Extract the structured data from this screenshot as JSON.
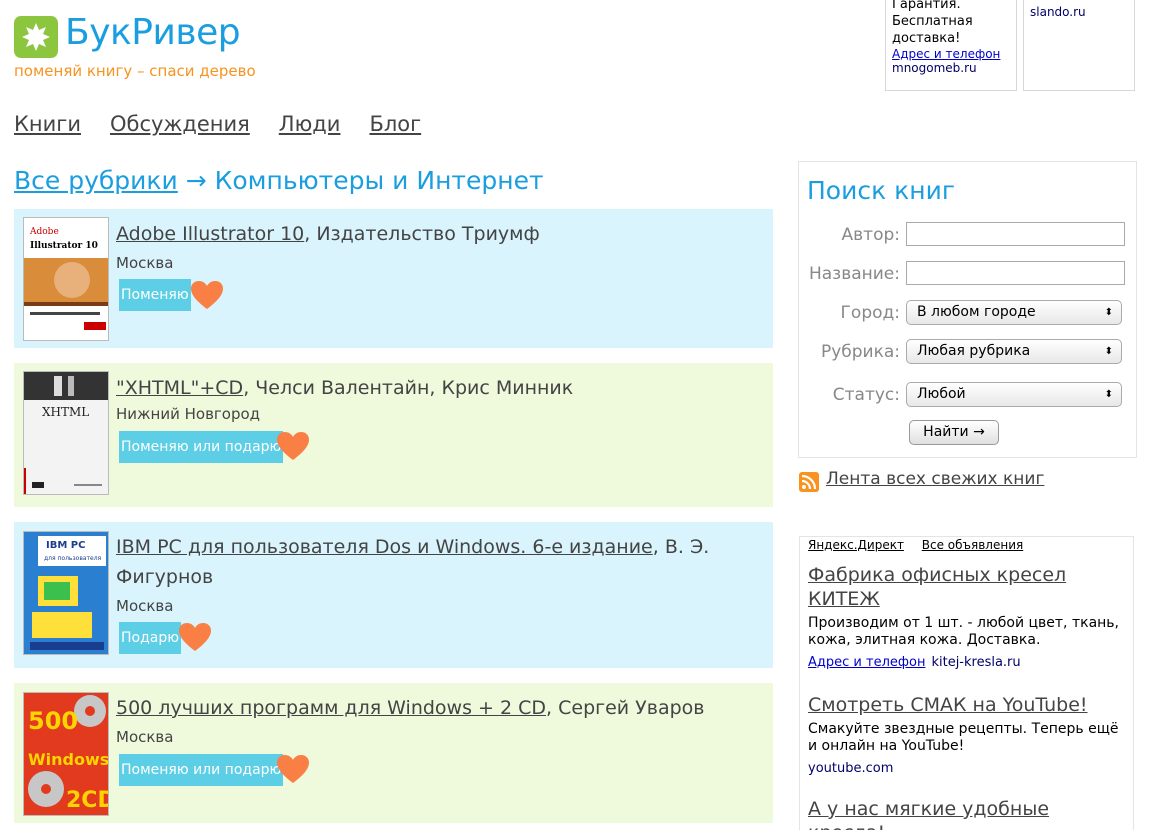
{
  "logo": {
    "name": "БукРивер",
    "slogan": "поменяй книгу – спаси дерево"
  },
  "top_ads": [
    {
      "text": "Гарантия. Бесплатная доставка!",
      "link": "Адрес и телефон",
      "domain": "mnogomeb.ru"
    },
    {
      "text": "",
      "link": "",
      "domain": "slando.ru"
    }
  ],
  "nav": [
    "Книги",
    "Обсуждения",
    "Люди",
    "Блог"
  ],
  "breadcrumb": {
    "root": "Все рубрики",
    "arrow": "→",
    "current": "Компьютеры и Интернет"
  },
  "books": [
    {
      "title": "Adobe Illustrator 10",
      "author": ", Издательство Триумф",
      "city": "Москва",
      "status": "Поменяю",
      "cover": "adobe-illustrator-cover"
    },
    {
      "title": "\"XHTML\"+CD",
      "author": ", Челси Валентайн, Крис Минник",
      "city": "Нижний Новгород",
      "status": "Поменяю или подарю",
      "cover": "xhtml-cover"
    },
    {
      "title": "IBM PC для пользователя Dos и Windows. 6-е издание",
      "author": ", В. Э. Фигурнов",
      "city": "Москва",
      "status": "Подарю",
      "cover": "ibm-pc-cover"
    },
    {
      "title": "500 лучших программ для Windows + 2 CD",
      "author": ", Сергей Уваров",
      "city": "Москва",
      "status": "Поменяю или подарю",
      "cover": "windows-500-cover"
    }
  ],
  "search": {
    "title": "Поиск книг",
    "author_label": "Автор:",
    "name_label": "Название:",
    "city_label": "Город:",
    "city_value": "В любом городе",
    "rubric_label": "Рубрика:",
    "rubric_value": "Любая рубрика",
    "status_label": "Статус:",
    "status_value": "Любой",
    "button": "Найти →"
  },
  "rss": {
    "label": "Лента всех свежих книг"
  },
  "direct": {
    "header_left": "Яндекс.Директ",
    "header_right": "Все объявления",
    "ads": [
      {
        "title": "Фабрика офисных кресел КИТЕЖ",
        "body": "Производим от 1 шт. - любой цвет, ткань, кожа, элитная кожа. Доставка.",
        "link": "Адрес и телефон",
        "domain": "kitej-kresla.ru"
      },
      {
        "title": "Смотреть СМАК на YouTube!",
        "body": "Смакуйте звездные рецепты. Теперь ещё и онлайн на YouTube!",
        "link": "",
        "domain": "youtube.com"
      },
      {
        "title": "А у нас мягкие удобные кресла!",
        "body": "",
        "link": "",
        "domain": ""
      }
    ]
  },
  "colors": {
    "brand_blue": "#1a9ee0",
    "brand_orange": "#f7931e",
    "badge": "#5ccfe6",
    "card_blue": "#d9f4fc",
    "card_green": "#effadc"
  }
}
